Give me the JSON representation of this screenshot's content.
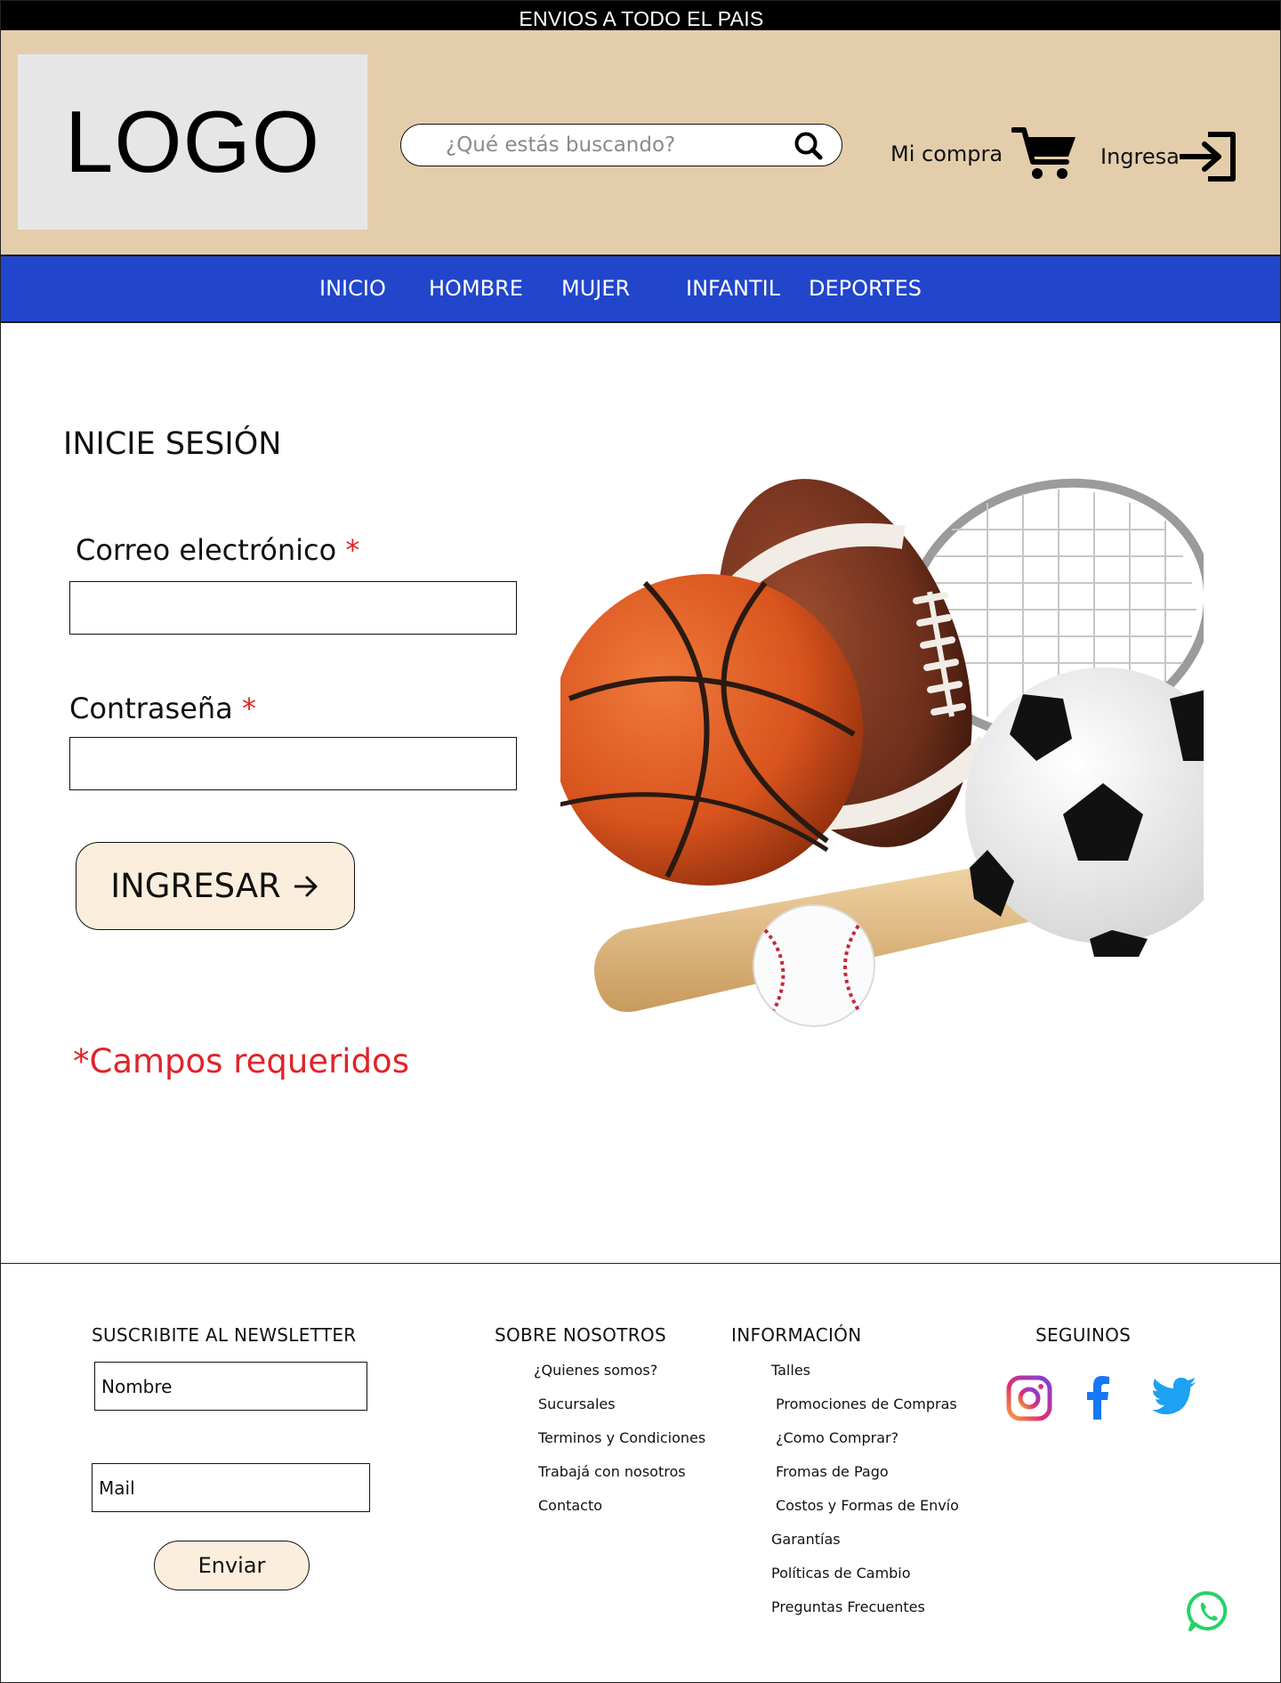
{
  "topbar": {
    "text": "ENVIOS A TODO EL PAIS"
  },
  "header": {
    "logo_text": "LOGO",
    "search_placeholder": "¿Qué estás buscando?",
    "cart_label": "Mi compra",
    "login_label": "Ingresa"
  },
  "nav": {
    "items": [
      {
        "label": "INICIO"
      },
      {
        "label": "HOMBRE"
      },
      {
        "label": "MUJER"
      },
      {
        "label": "INFANTIL"
      },
      {
        "label": "DEPORTES"
      }
    ]
  },
  "login_form": {
    "title": "INICIE SESIÓN",
    "email_label": "Correo electrónico",
    "password_label": "Contraseña",
    "required_mark": "*",
    "submit_label": "INGRESAR",
    "required_note": "*Campos requeridos"
  },
  "footer": {
    "newsletter": {
      "heading": "SUSCRIBITE AL NEWSLETTER",
      "name_placeholder": "Nombre",
      "mail_placeholder": "Mail",
      "submit_label": "Enviar"
    },
    "about": {
      "heading": "SOBRE NOSOTROS",
      "links": [
        "¿Quienes somos?",
        "Sucursales",
        "Terminos y Condiciones",
        "Trabajá con nosotros",
        "Contacto"
      ]
    },
    "info": {
      "heading": "INFORMACIÓN",
      "links": [
        "Talles",
        "Promociones de Compras",
        "¿Como Comprar?",
        "Fromas de Pago",
        "Costos y Formas de Envío",
        "Garantías",
        "Políticas de Cambio",
        "Preguntas Frecuentes"
      ]
    },
    "social": {
      "heading": "SEGUINOS",
      "icons": [
        "instagram-icon",
        "facebook-icon",
        "twitter-icon"
      ]
    }
  },
  "colors": {
    "topbar": "#000000",
    "header_bg": "#e3cdab",
    "nav_bg": "#2146cc",
    "button_bg": "#fbeedd",
    "required": "#e0232a",
    "whatsapp": "#25d366",
    "facebook": "#1877f2",
    "twitter": "#1da1f2"
  }
}
